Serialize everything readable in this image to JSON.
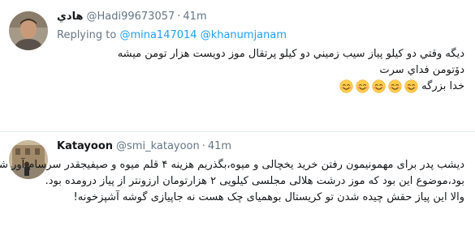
{
  "tweets": [
    {
      "author": {
        "name": "هادي",
        "handle": "@Hadi99673057"
      },
      "dot": "·",
      "time": "41m",
      "replying": {
        "prefix": "Replying to",
        "users": [
          "@mina147014",
          "@khanumjanam"
        ]
      },
      "lines": [
        "ديگه وقتي دو كيلو پياز سيب زميني دو كيلو پرتقال موز دويست هزار تومن ميشه",
        "دۆتومن فداي سرت",
        "خدا بزرگه"
      ],
      "emoji_icon": "smiling-face-with-smiling-eyes-icon",
      "emoji_count": 5
    },
    {
      "author": {
        "name": "Katayoon",
        "handle": "@smi_katayoon"
      },
      "dot": "·",
      "time": "41m",
      "lines": [
        "دیشب پدر برای مهمونیمون رفتن خرید یخچالی و میوه،بگذریم هزینه ۴ قلم میوه و صیفیجقدر سرسام آور شده",
        "بود،موضوع این بود که موز درشت هلالی مجلسی کیلویی ۲ هزارتومان ارزونتر از پیاز درومده بود.",
        "والا این پیاز حقش چیده شدن تو کریستال بوهمیای چک هست نه جاپیازی گوشه آشپزخونه!"
      ]
    }
  ],
  "colors": {
    "link": "#1da1f2",
    "muted": "#657786",
    "text": "#14171a",
    "divider": "#e6ecf0"
  }
}
